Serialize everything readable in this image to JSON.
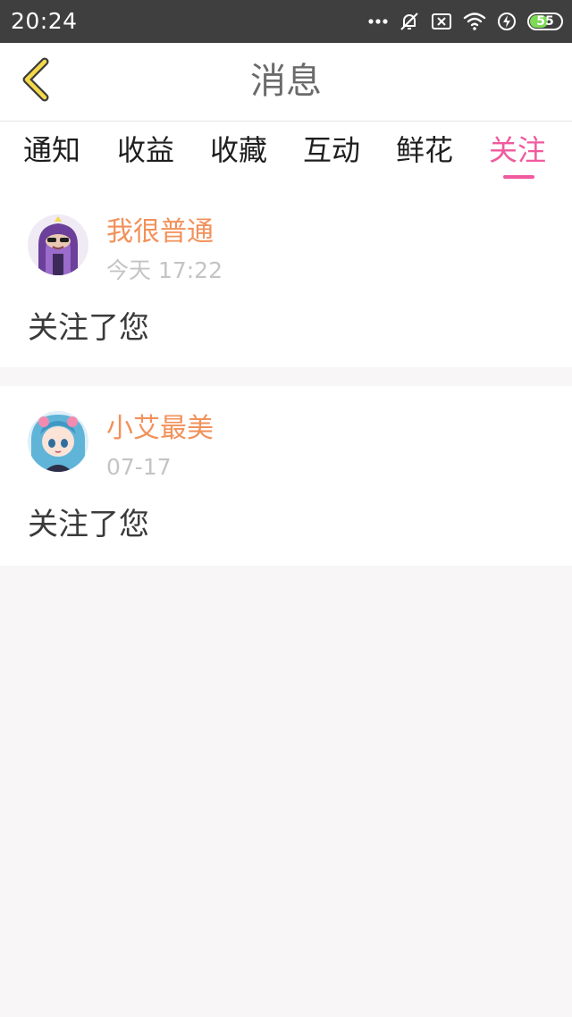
{
  "status_bar": {
    "time": "20:24",
    "battery": "55",
    "icons": [
      "more-dots-icon",
      "alarm-off-icon",
      "sim-x-icon",
      "wifi-icon",
      "charging-icon",
      "battery-icon"
    ]
  },
  "header": {
    "title": "消息",
    "back_icon": "chevron-left-icon"
  },
  "tabs": [
    {
      "label": "通知",
      "active": false
    },
    {
      "label": "收益",
      "active": false
    },
    {
      "label": "收藏",
      "active": false
    },
    {
      "label": "互动",
      "active": false
    },
    {
      "label": "鲜花",
      "active": false
    },
    {
      "label": "关注",
      "active": true
    }
  ],
  "notifications": [
    {
      "username": "我很普通",
      "time": "今天 17:22",
      "message": "关注了您"
    },
    {
      "username": "小艾最美",
      "time": "07-17",
      "message": "关注了您"
    }
  ],
  "colors": {
    "accent_pink": "#f05a9e",
    "username_orange": "#f2915a",
    "back_yellow": "#f4d94a",
    "status_bar_bg": "#3f3f3f",
    "page_bg": "#f8f6f7"
  }
}
